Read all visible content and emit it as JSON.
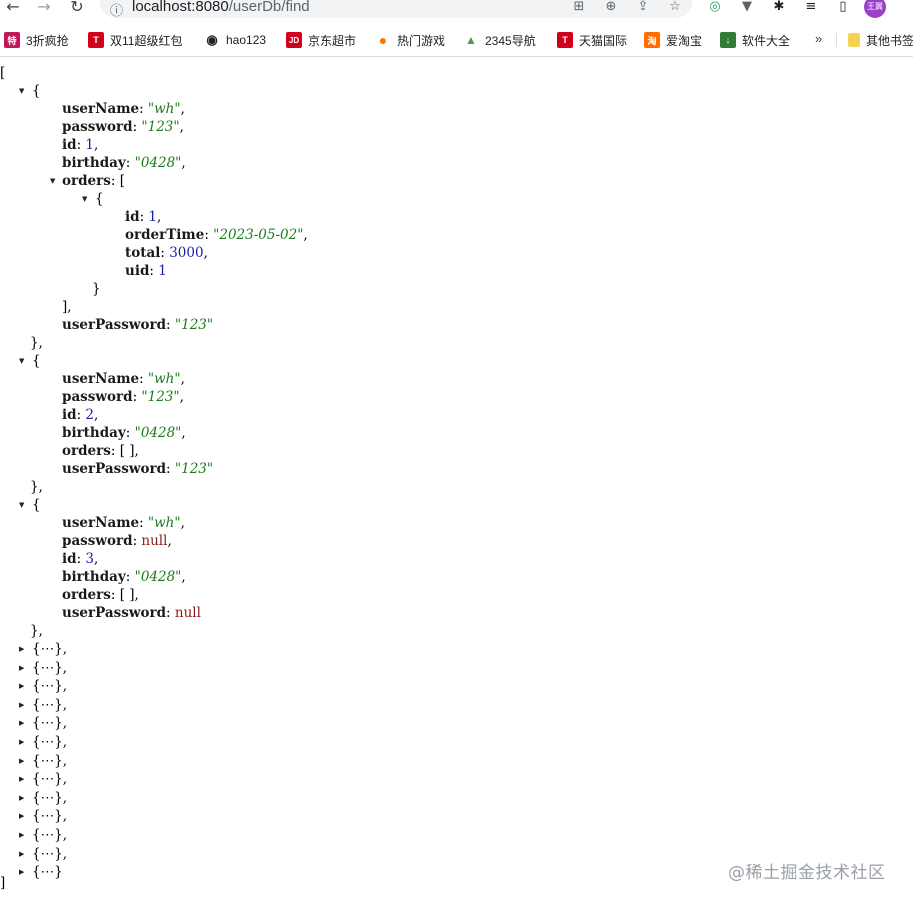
{
  "browser": {
    "url_host": "localhost:8080",
    "url_path": "/userDb/find",
    "profile_label": "王翼",
    "nav_glyphs": {
      "back": "←",
      "forward": "→",
      "reload": "↻",
      "info": "ⓘ"
    },
    "omnibox_glyphs": [
      "⊞",
      "⊕",
      "⇪",
      "☆"
    ],
    "extension_glyphs": [
      "◎",
      "▼",
      "✱",
      "≡",
      "▯"
    ]
  },
  "bookmarks": [
    {
      "label": "3折疯抢",
      "icon_char": "特",
      "color": "#c2185b"
    },
    {
      "label": "双11超级红包",
      "icon_char": "T",
      "color": "#d0021b"
    },
    {
      "label": "hao123",
      "icon_char": "◉",
      "color": "#222222"
    },
    {
      "label": "京东超市",
      "icon_char": "JD",
      "color": "#d0021b"
    },
    {
      "label": "热门游戏",
      "icon_char": "●",
      "color": "#f57c00"
    },
    {
      "label": "2345导航",
      "icon_char": "▲",
      "color": "#43a047"
    },
    {
      "label": "天猫国际",
      "icon_char": "T",
      "color": "#d0021b"
    },
    {
      "label": "爱淘宝",
      "icon_char": "淘",
      "color": "#ff6d00"
    },
    {
      "label": "软件大全",
      "icon_char": "↓",
      "color": "#2e7d32"
    }
  ],
  "bookmarks_more": "»",
  "other_bookmarks": {
    "label": "其他书签",
    "icon_char": "",
    "color": "#f7d154"
  },
  "json_view": {
    "open_bracket": "[",
    "close_bracket": "]",
    "expanded": [
      {
        "userName": "\"wh\"",
        "password": "\"123\"",
        "id": "1",
        "birthday": "\"0428\"",
        "orders": [
          {
            "id": "1",
            "orderTime": "\"2023-05-02\"",
            "total": "3000",
            "uid": "1"
          }
        ],
        "userPassword": "\"123\""
      },
      {
        "userName": "\"wh\"",
        "password": "\"123\"",
        "id": "2",
        "birthday": "\"0428\"",
        "orders": "[ ]",
        "userPassword": "\"123\""
      },
      {
        "userName": "\"wh\"",
        "password": "null",
        "id": "3",
        "birthday": "\"0428\"",
        "orders": "[ ]",
        "userPassword": "null"
      }
    ],
    "collapsed_count": 13,
    "collapsed_text": "{⋯}",
    "toggle_open": "▼",
    "toggle_closed": "▶"
  },
  "watermark": "@稀土掘金技术社区"
}
